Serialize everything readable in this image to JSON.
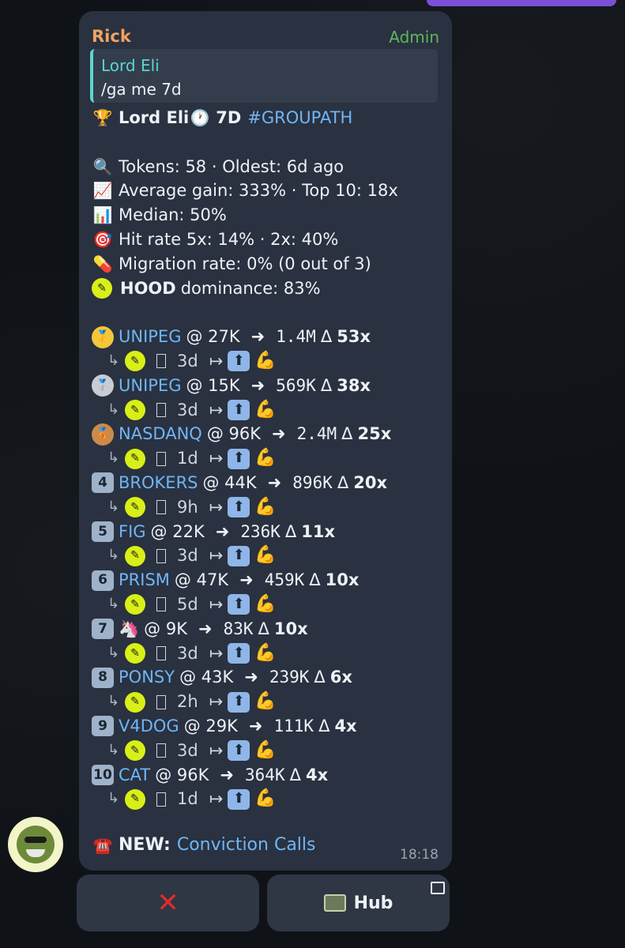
{
  "message": {
    "sender": "Rick",
    "role": "Admin",
    "reply": {
      "author": "Lord Eli",
      "text": "/ga me 7d"
    },
    "header": {
      "name": "Lord Eli",
      "period": "7D",
      "tag": "#GROUPATH"
    },
    "stats": [
      {
        "icon": "magnifier-icon",
        "emoji": "🔍",
        "text": "Tokens: 58 · Oldest: 6d ago"
      },
      {
        "icon": "chart-up-icon",
        "emoji": "📈",
        "text": "Average gain: 333% · Top 10: 18x"
      },
      {
        "icon": "bar-chart-icon",
        "emoji": "📊",
        "text": "Median: 50%"
      },
      {
        "icon": "target-icon",
        "emoji": "🎯",
        "text": "Hit rate 5x: 14% · 2x: 40%"
      },
      {
        "icon": "pill-icon",
        "emoji": "💊",
        "text": "Migration rate: 0% (0 out of 3)"
      }
    ],
    "dominance": {
      "name": "HOOD",
      "text": "dominance: 83%"
    },
    "tokens": [
      {
        "rank": "🥇",
        "rank_style": "gold",
        "name": "UNIPEG",
        "entry": "@ 27K",
        "arrow": "➜",
        "exit": "1.4M",
        "delta": "Δ",
        "mult": "53x",
        "age": "3d"
      },
      {
        "rank": "🥈",
        "rank_style": "silver",
        "name": "UNIPEG",
        "entry": "@ 15K",
        "arrow": "➜",
        "exit": "569K",
        "delta": "Δ",
        "mult": "38x",
        "age": "3d"
      },
      {
        "rank": "🥉",
        "rank_style": "bronze",
        "name": "NASDANQ",
        "entry": "@ 96K",
        "arrow": "➜",
        "exit": "2.4M",
        "delta": "Δ",
        "mult": "25x",
        "age": "1d"
      },
      {
        "rank": "4",
        "rank_style": "box",
        "name": "BROKERS",
        "entry": "@ 44K",
        "arrow": "➜",
        "exit": "896K",
        "delta": "Δ",
        "mult": "20x",
        "age": "9h"
      },
      {
        "rank": "5",
        "rank_style": "box",
        "name": "FIG",
        "entry": "@ 22K",
        "arrow": "➜",
        "exit": "236K",
        "delta": "Δ",
        "mult": "11x",
        "age": "3d"
      },
      {
        "rank": "6",
        "rank_style": "box",
        "name": "PRISM",
        "entry": "@ 47K",
        "arrow": "➜",
        "exit": "459K",
        "delta": "Δ",
        "mult": "10x",
        "age": "5d"
      },
      {
        "rank": "7",
        "rank_style": "box",
        "name": "🦄",
        "entry": "@ 9K",
        "arrow": "➜",
        "exit": "83K",
        "delta": "Δ",
        "mult": "10x",
        "age": "3d"
      },
      {
        "rank": "8",
        "rank_style": "box",
        "name": "PONSY",
        "entry": "@ 43K",
        "arrow": "➜",
        "exit": "239K",
        "delta": "Δ",
        "mult": "6x",
        "age": "2h"
      },
      {
        "rank": "9",
        "rank_style": "box",
        "name": "V4DOG",
        "entry": "@ 29K",
        "arrow": "➜",
        "exit": "111K",
        "delta": "Δ",
        "mult": "4x",
        "age": "3d"
      },
      {
        "rank": "10",
        "rank_style": "box",
        "name": "CAT",
        "entry": "@ 96K",
        "arrow": "➜",
        "exit": "364K",
        "delta": "Δ",
        "mult": "4x",
        "age": "1d"
      }
    ],
    "sub_row": {
      "hook": "↳",
      "pill": "✎",
      "mid_arrow": "↦",
      "up": "⬆",
      "flex": "💪"
    },
    "footer": {
      "emoji": "☎️",
      "label": "NEW:",
      "link": "Conviction Calls"
    },
    "time": "18:18"
  },
  "keyboard": {
    "close": "✕",
    "hub": "Hub"
  },
  "colors": {
    "bubble": "#2a3140",
    "link": "#6fb6f5",
    "sender": "#f0a35e",
    "admin": "#5cb85c",
    "accent_quote": "#5ad6d0"
  }
}
